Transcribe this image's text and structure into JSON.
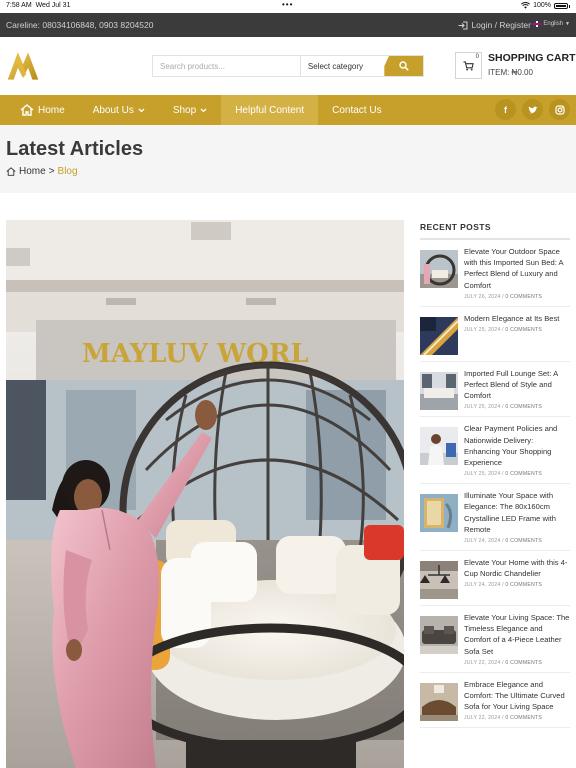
{
  "status_bar": {
    "time": "7:58 AM",
    "date": "Wed Jul 31",
    "battery": "100%"
  },
  "topbar": {
    "careline": "Careline: 08034106848, 0903 8204520",
    "login": "Login / Register",
    "language": "English"
  },
  "header": {
    "search_placeholder": "Search products...",
    "category": "Select category",
    "cart_count": "0",
    "cart_title": "SHOPPING CART",
    "cart_item": "ITEM: ₦0.00"
  },
  "nav": {
    "items": [
      {
        "label": "Home"
      },
      {
        "label": "About Us"
      },
      {
        "label": "Shop"
      },
      {
        "label": "Helpful Content"
      },
      {
        "label": "Contact Us"
      }
    ],
    "socials": [
      "facebook-icon",
      "twitter-icon",
      "instagram-icon"
    ]
  },
  "page": {
    "title": "Latest Articles",
    "breadcrumb": {
      "home": "Home",
      "separator": ">",
      "current": "Blog"
    }
  },
  "hero": {
    "store_sign": "MAYLUV WORL"
  },
  "sidebar": {
    "title": "RECENT POSTS",
    "posts": [
      {
        "title": "Elevate Your Outdoor Space with this Imported Sun Bed: A Perfect Blend of Luxury and Comfort",
        "date": "JULY 26, 2024",
        "comments": "0 COMMENTS"
      },
      {
        "title": "Modern Elegance at Its Best",
        "date": "JULY 25, 2024",
        "comments": "0 COMMENTS"
      },
      {
        "title": "Imported Full Lounge Set: A Perfect Blend of Style and Comfort",
        "date": "JULY 25, 2024",
        "comments": "0 COMMENTS"
      },
      {
        "title": "Clear Payment Policies and Nationwide Delivery: Enhancing Your Shopping Experience",
        "date": "JULY 25, 2024",
        "comments": "0 COMMENTS"
      },
      {
        "title": "Illuminate Your Space with Elegance: The 80x160cm Crystalline LED Frame with Remote",
        "date": "JULY 24, 2024",
        "comments": "0 COMMENTS"
      },
      {
        "title": "Elevate Your Home with this 4-Cup Nordic Chandelier",
        "date": "JULY 24, 2024",
        "comments": "0 COMMENTS"
      },
      {
        "title": "Elevate Your Living Space: The Timeless Elegance and Comfort of a 4-Piece Leather Sofa Set",
        "date": "JULY 22, 2024",
        "comments": "0 COMMENTS"
      },
      {
        "title": "Embrace Elegance and Comfort: The Ultimate Curved Sofa for Your Living Space",
        "date": "JULY 22, 2024",
        "comments": "0 COMMENTS"
      }
    ]
  },
  "colors": {
    "accent": "#c6a02a",
    "topbar": "#3b3b3b",
    "title_bg": "#f5f5f5"
  }
}
